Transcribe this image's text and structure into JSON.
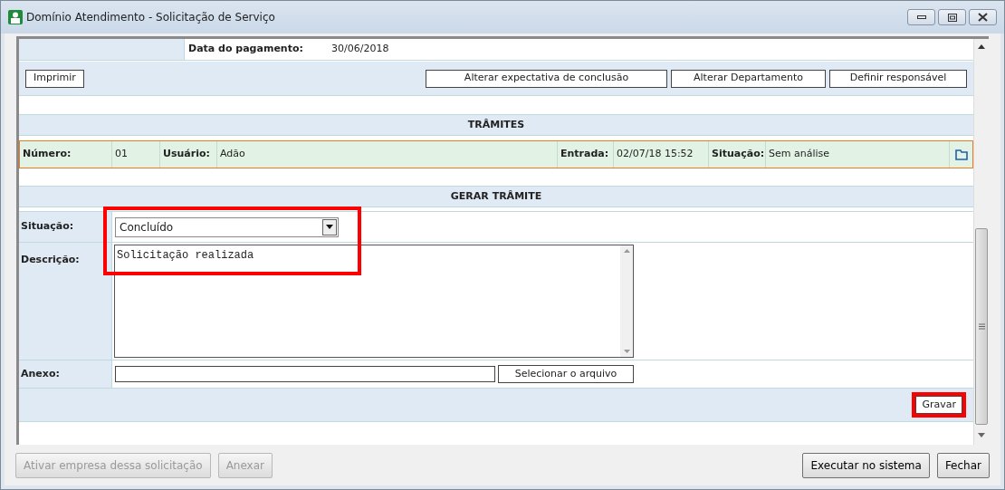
{
  "window": {
    "title": "Domínio Atendimento - Solicitação de Serviço"
  },
  "payment": {
    "label": "Data do pagamento:",
    "value": "30/06/2018"
  },
  "actions": {
    "left": "Imprimir",
    "right": [
      "Alterar expectativa de conclusão",
      "Alterar Departamento",
      "Definir responsável"
    ]
  },
  "tramites": {
    "title": "TRÂMITES",
    "rows": [
      {
        "numero_label": "Número:",
        "numero": "01",
        "usuario_label": "Usuário:",
        "usuario": "Adão",
        "entrada_label": "Entrada:",
        "entrada": "02/07/18 15:52",
        "situacao_label": "Situação:",
        "situacao": "Sem análise",
        "selected": true
      }
    ]
  },
  "gerar": {
    "title": "GERAR TRÂMITE",
    "highlighted": true,
    "situacao": {
      "label": "Situação:",
      "value": "Concluído"
    },
    "descricao": {
      "label": "Descrição:",
      "value": "Solicitação realizada"
    },
    "anexo": {
      "label": "Anexo:",
      "button": "Selecionar o arquivo"
    },
    "save": {
      "label": "Gravar",
      "highlighted": true
    }
  },
  "footer": {
    "left": [
      {
        "label": "Ativar empresa dessa solicitação",
        "disabled": true
      },
      {
        "label": "Anexar",
        "disabled": true
      }
    ],
    "right": [
      {
        "label": "Executar no sistema",
        "disabled": false
      },
      {
        "label": "Fechar",
        "disabled": false
      }
    ]
  }
}
